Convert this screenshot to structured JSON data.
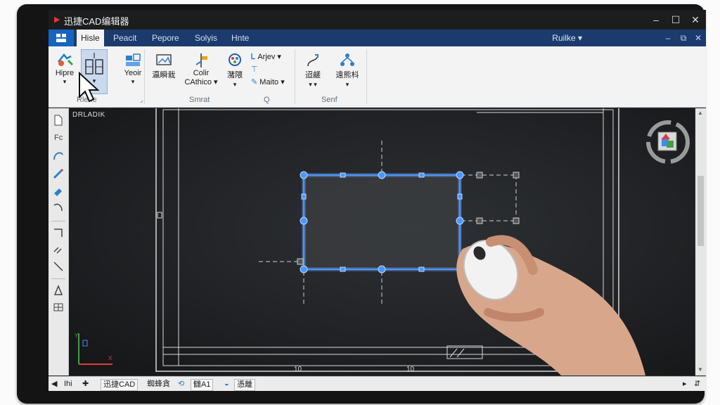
{
  "window": {
    "title": "迅捷CAD编辑器",
    "app_icon": "cad-logo-icon",
    "controls": [
      "minimize-icon",
      "maximize-icon",
      "close-icon"
    ]
  },
  "ribbon_tabs": {
    "file_icon": "app-menu-icon",
    "tabs": [
      "Hisle",
      "Peacit",
      "Pepore",
      "Solyis",
      "Hnte"
    ],
    "active_index": 0,
    "profile": "Ruilke ▾"
  },
  "ribbon": {
    "buttons": [
      {
        "label": "Hipre",
        "icon": "move-icon"
      },
      {
        "label": "",
        "icon": "columns-icon"
      },
      {
        "label": "Yeoir",
        "icon": "layer-icon"
      },
      {
        "label": "瀛瞬栽",
        "icon": "image-icon"
      },
      {
        "label": "Colir",
        "label2": "CAthico ▾",
        "icon": "align-icon"
      },
      {
        "label": "潴隈",
        "icon": "palette-icon"
      },
      {
        "label": "Arjev ▾",
        "icon": "text-icon"
      },
      {
        "label": "Maito ▾",
        "icon": "pen-icon"
      },
      {
        "label": "迢鹺",
        "icon": "route-icon"
      },
      {
        "label": "遠熊枓",
        "icon": "share-icon"
      }
    ],
    "groups": [
      "Rlene",
      "Smrat",
      "Q",
      "Senf"
    ]
  },
  "canvas": {
    "label": "DRLADIK",
    "tick_labels": [
      "10",
      "10"
    ],
    "selection_color": "#3d8bff",
    "background": "#232528"
  },
  "status": {
    "items": [
      "Ihi",
      "迅捷CAD",
      "蜘蜂貪",
      "讎A1",
      "憑離"
    ]
  }
}
